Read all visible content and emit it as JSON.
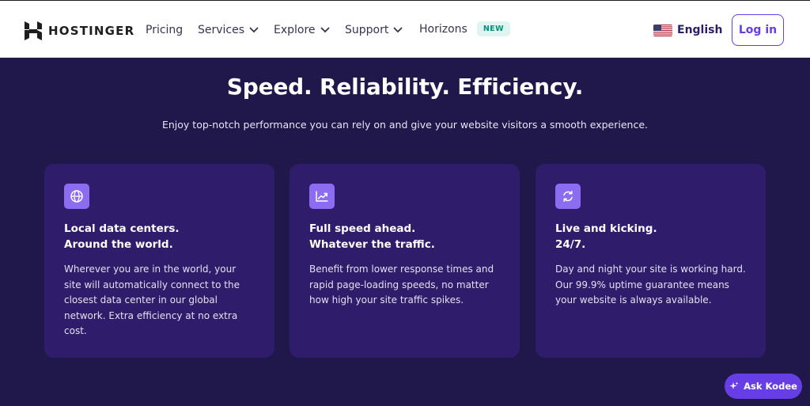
{
  "header": {
    "logo_text": "HOSTINGER",
    "nav": [
      {
        "label": "Pricing"
      },
      {
        "label": "Services"
      },
      {
        "label": "Explore"
      },
      {
        "label": "Support"
      },
      {
        "label": "Horizons",
        "badge": "NEW"
      }
    ],
    "language": "English",
    "login_label": "Log in"
  },
  "hero": {
    "title": "Speed. Reliability. Efficiency.",
    "subtitle": "Enjoy top-notch performance you can rely on and give your website visitors a smooth experience."
  },
  "cards": [
    {
      "icon": "globe-icon",
      "title_line1": "Local data centers.",
      "title_line2": "Around the world.",
      "text": "Wherever you are in the world, your site will automatically connect to the closest data center in our global network. Extra efficiency at no extra cost."
    },
    {
      "icon": "trending-up-icon",
      "title_line1": "Full speed ahead.",
      "title_line2": "Whatever the traffic.",
      "text": "Benefit from lower response times and rapid page-loading speeds, no matter how high your site traffic spikes."
    },
    {
      "icon": "refresh-icon",
      "title_line1": "Live and kicking.",
      "title_line2": "24/7.",
      "text": "Day and night your site is working hard. Our 99.9% uptime guarantee means your website is always available."
    }
  ],
  "chat": {
    "label": "Ask Kodee"
  },
  "colors": {
    "background": "#20184a",
    "card": "#2f1c6a",
    "accent": "#673de6",
    "icon_bg": "#8c6cf0"
  }
}
